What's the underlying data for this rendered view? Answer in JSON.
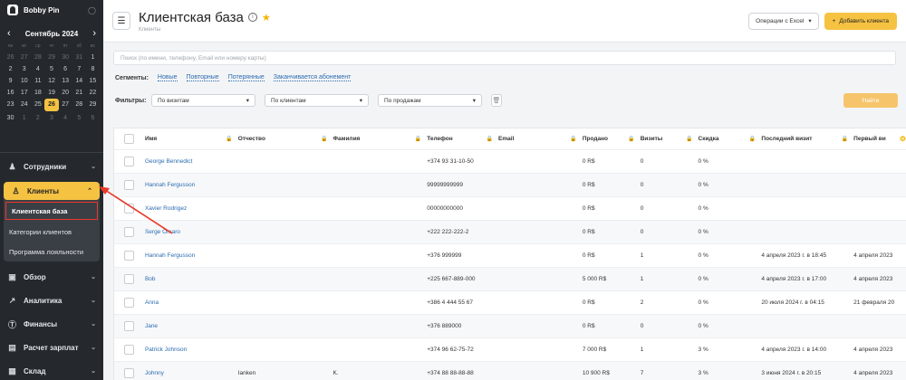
{
  "app": {
    "brand": "Bobby Pin"
  },
  "calendar": {
    "month": "Сентябрь 2024",
    "weekdays": [
      "пн",
      "вт",
      "ср",
      "чт",
      "пт",
      "сб",
      "вс"
    ],
    "weeks": [
      [
        "26",
        "27",
        "28",
        "29",
        "30",
        "31",
        "1"
      ],
      [
        "2",
        "3",
        "4",
        "5",
        "6",
        "7",
        "8"
      ],
      [
        "9",
        "10",
        "11",
        "12",
        "13",
        "14",
        "15"
      ],
      [
        "16",
        "17",
        "18",
        "19",
        "20",
        "21",
        "22"
      ],
      [
        "23",
        "24",
        "25",
        "26",
        "27",
        "28",
        "29"
      ],
      [
        "30",
        "1",
        "2",
        "3",
        "4",
        "5",
        "6"
      ]
    ],
    "today": "26"
  },
  "nav": {
    "employees": "Сотрудники",
    "clients": "Клиенты",
    "clients_sub": [
      "Клиентская база",
      "Категории клиентов",
      "Программа лояльности"
    ],
    "overview": "Обзор",
    "analytics": "Аналитика",
    "finance": "Финансы",
    "payroll": "Расчет зарплат",
    "warehouse": "Склад"
  },
  "header": {
    "title": "Клиентская база",
    "breadcrumb": "Клиенты",
    "excel_btn": "Операции с Excel",
    "add_btn": "Добавить клиента"
  },
  "search": {
    "placeholder": "Поиск (по имени, телефону, Email или номеру карты)"
  },
  "segments": {
    "label": "Сегменты:",
    "items": [
      "Новые",
      "Повторные",
      "Потерянные",
      "Заканчивается абонемент"
    ]
  },
  "filters": {
    "label": "Фильтры:",
    "selects": [
      "По визитам",
      "По клиентам",
      "По продажам"
    ],
    "find_btn": "Найти"
  },
  "table": {
    "columns": [
      "Имя",
      "Отчество",
      "Фамилия",
      "Телефон",
      "Email",
      "Продано",
      "Визиты",
      "Скидка",
      "Последний визит",
      "Первый ви"
    ],
    "rows": [
      [
        "George Bennedict",
        "",
        "",
        "+374 93 31-10-50",
        "",
        "0 R$",
        "0",
        "0 %",
        "",
        ""
      ],
      [
        "Hannah Fergusson",
        "",
        "",
        "99999999999",
        "",
        "0 R$",
        "0",
        "0 %",
        "",
        ""
      ],
      [
        "Xavier Rodrigez",
        "",
        "",
        "00000000000",
        "",
        "0 R$",
        "0",
        "0 %",
        "",
        ""
      ],
      [
        "Serge Omaro",
        "",
        "",
        "+222 222-222-2",
        "",
        "0 R$",
        "0",
        "0 %",
        "",
        ""
      ],
      [
        "Hannah Fergusson",
        "",
        "",
        "+376 999999",
        "",
        "0 R$",
        "1",
        "0 %",
        "4 апреля 2023 г. в 18:45",
        "4 апреля 2023"
      ],
      [
        "Bob",
        "",
        "",
        "+225 667-889-000",
        "",
        "5 000 R$",
        "1",
        "0 %",
        "4 апреля 2023 г. в 17:00",
        "4 апреля 2023"
      ],
      [
        "Anna",
        "",
        "",
        "+386 4 444 55 67",
        "",
        "0 R$",
        "2",
        "0 %",
        "20 июля 2024 г. в 04:15",
        "21 февраля 20"
      ],
      [
        "Jane",
        "",
        "",
        "+376 889000",
        "",
        "0 R$",
        "0",
        "0 %",
        "",
        ""
      ],
      [
        "Patrick Johnson",
        "",
        "",
        "+374 96 62-75-72",
        "",
        "7 000 R$",
        "1",
        "3 %",
        "4 апреля 2023 г. в 14:00",
        "4 апреля 2023"
      ],
      [
        "Johnny",
        "Ianken",
        "K.",
        "+374 88 88-88-88",
        "",
        "10 900 R$",
        "7",
        "3 %",
        "3 июня 2024 г. в 20:15",
        "4 апреля 2023"
      ]
    ]
  },
  "colors": {
    "accent": "#f5c242",
    "sidebar": "#25292e",
    "link": "#2b6cb0",
    "annotation": "#e8392b"
  }
}
